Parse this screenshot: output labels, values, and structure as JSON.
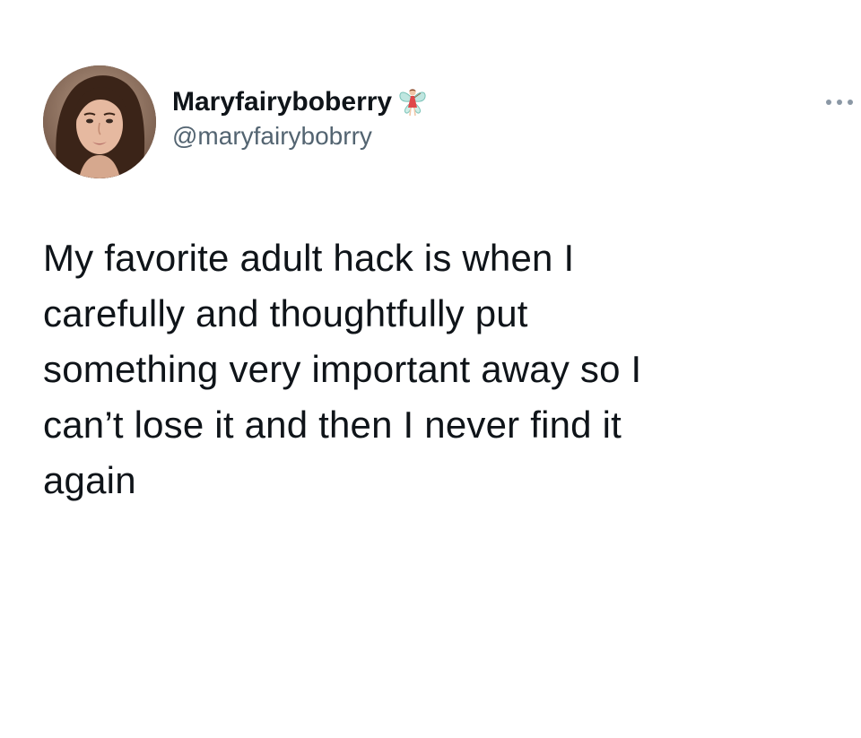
{
  "tweet": {
    "author": {
      "display_name": "Maryfairyboberry",
      "name_emoji": "fairy-icon",
      "handle": "@maryfairybobrry",
      "avatar": "profile-photo"
    },
    "more_menu_icon": "more-dots-icon",
    "text": "My favorite adult hack is when I\ncarefully and thoughtfully put\nsomething very important away so I\ncan’t lose it and then I never find it\nagain"
  },
  "colors": {
    "text_primary": "#0f1419",
    "text_secondary": "#536471",
    "background": "#ffffff"
  }
}
